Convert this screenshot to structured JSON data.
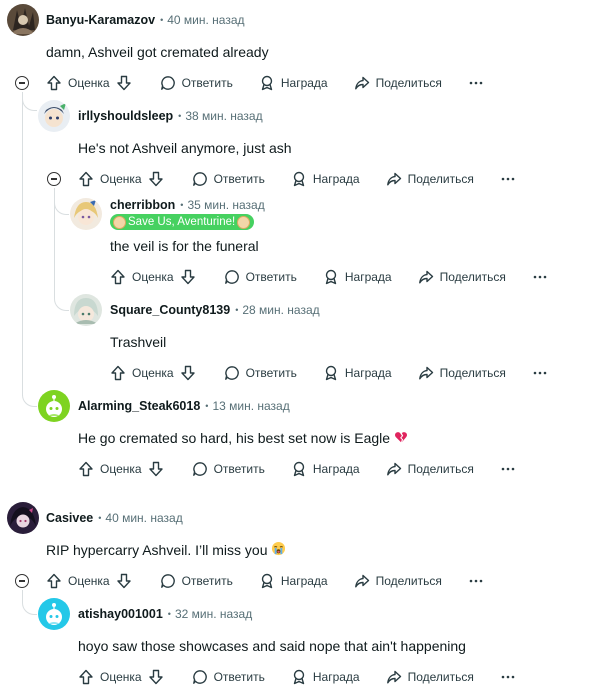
{
  "actions": {
    "vote": "Оценка",
    "reply": "Ответить",
    "award": "Награда",
    "share": "Поделиться"
  },
  "comments": [
    {
      "user": "Banyu-Karamazov",
      "time": "40 мин. назад",
      "text": "damn, Ashveil got cremated already"
    },
    {
      "user": "irllyshouldsleep",
      "time": "38 мин. назад",
      "text": "He's not Ashveil anymore, just ash"
    },
    {
      "user": "cherribbon",
      "time": "35 мин. назад",
      "flair": "Save Us, Aventurine!",
      "text": "the veil is for the funeral"
    },
    {
      "user": "Square_County8139",
      "time": "28 мин. назад",
      "text": "Trashveil"
    },
    {
      "user": "Alarming_Steak6018",
      "time": "13 мин. назад",
      "text": "He go cremated so hard, his best set now is Eagle",
      "emoji": "broken-heart-icon"
    },
    {
      "user": "Casivee",
      "time": "40 мин. назад",
      "text": "RIP hypercarry Ashveil. I’ll miss you",
      "emoji": "crying-face-icon"
    },
    {
      "user": "atishay001001",
      "time": "32 мин. назад",
      "text": "hoyo saw those showcases and said nope that ain't happening"
    }
  ],
  "colors": {
    "flair": "#46d160",
    "thread_line": "#d9dee0",
    "meta": "#576f76"
  }
}
